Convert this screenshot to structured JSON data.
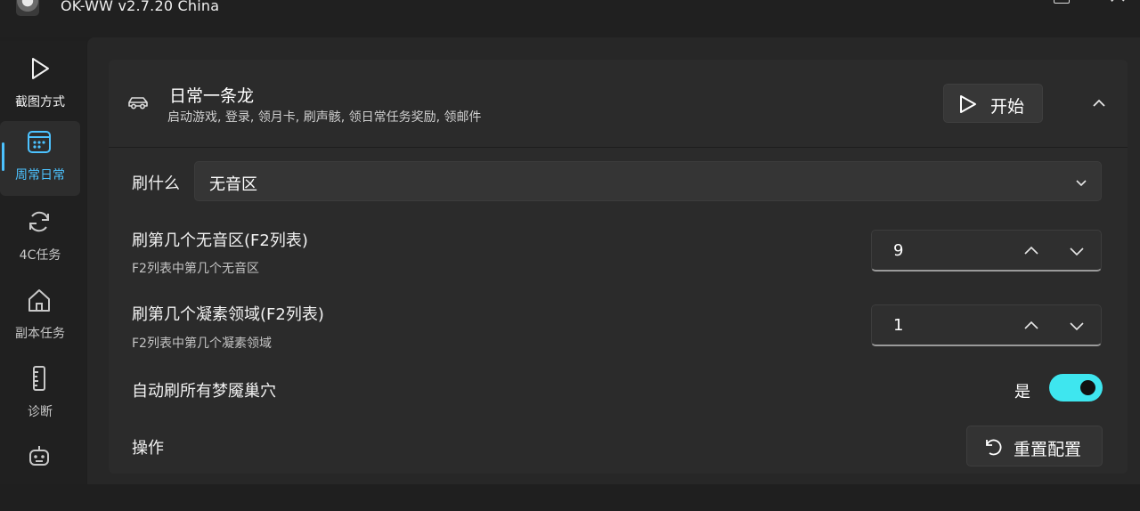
{
  "app": {
    "title": "OK-WW v2.7.20 China"
  },
  "nav": {
    "items": [
      {
        "label": "截图方式",
        "icon": "play-icon"
      },
      {
        "label": "周常日常",
        "icon": "calendar-icon"
      },
      {
        "label": "4C任务",
        "icon": "refresh-icon"
      },
      {
        "label": "副本任务",
        "icon": "home-icon"
      },
      {
        "label": "诊断",
        "icon": "ruler-icon"
      },
      {
        "label": "",
        "icon": "robot-icon"
      }
    ],
    "active_index": 1
  },
  "task": {
    "title": "日常一条龙",
    "description": "启动游戏, 登录, 领月卡, 刷声骸, 领日常任务奖励, 领邮件",
    "start_label": "开始",
    "expanded": true
  },
  "settings": {
    "farm_what": {
      "label": "刷什么",
      "value": "无音区"
    },
    "which_silent_zone": {
      "label": "刷第几个无音区(F2列表)",
      "description": "F2列表中第几个无音区",
      "value": "9"
    },
    "which_crystal_field": {
      "label": "刷第几个凝素领域(F2列表)",
      "description": "F2列表中第几个凝素领域",
      "value": "1"
    },
    "auto_nightmare_nest": {
      "label": "自动刷所有梦魇巢穴",
      "state_text": "是",
      "enabled": true
    },
    "actions": {
      "label": "操作",
      "reset_label": "重置配置"
    }
  },
  "colors": {
    "accent": "#4cc2ff",
    "toggle_on": "#3ee6ef",
    "background": "#1f1f1f",
    "card": "#2b2b2b"
  }
}
